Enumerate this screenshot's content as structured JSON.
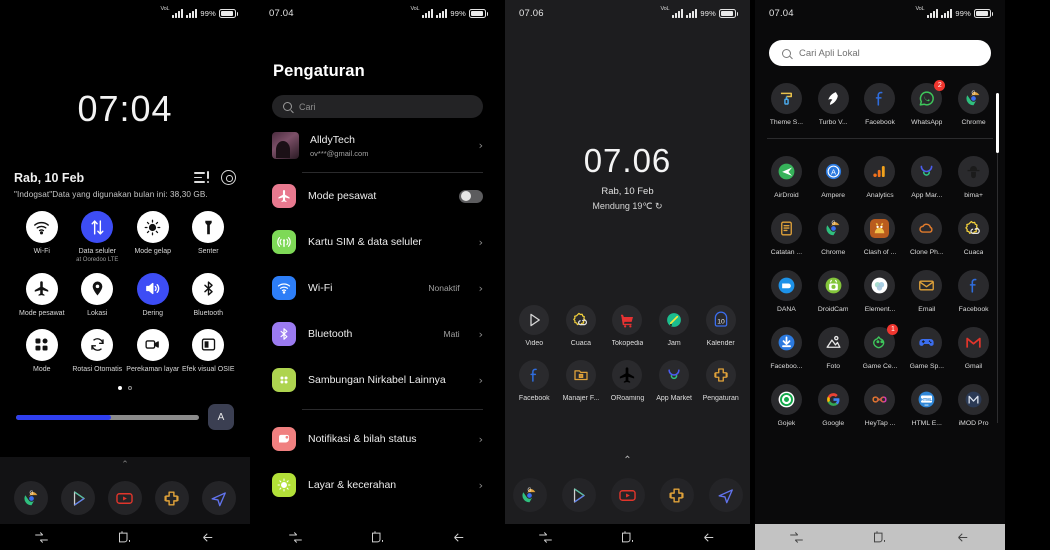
{
  "panel1": {
    "name": "notification-shade",
    "statusbar": {
      "time": "",
      "network": "VoLTE",
      "battery_pct": "99%"
    },
    "clock": "07:04",
    "date": "Rab, 10 Feb",
    "carrier_note": "\"Indogsat\"Data yang digunakan bulan ini: 38,30 GB.",
    "tiles": [
      {
        "label": "Wi-Fi",
        "sub": "",
        "icon": "wifi-icon",
        "active": false
      },
      {
        "label": "Data seluler",
        "sub": "at Ooredoo   LTE",
        "icon": "data-transfer-icon",
        "active": true
      },
      {
        "label": "Mode gelap",
        "sub": "",
        "icon": "brightness-icon",
        "active": false
      },
      {
        "label": "Senter",
        "sub": "",
        "icon": "flashlight-icon",
        "active": false
      },
      {
        "label": "Mode pesawat",
        "sub": "",
        "icon": "airplane-icon",
        "active": false
      },
      {
        "label": "Lokasi",
        "sub": "",
        "icon": "location-pin-icon",
        "active": false
      },
      {
        "label": "Dering",
        "sub": "",
        "icon": "volume-icon",
        "active": true
      },
      {
        "label": "Bluetooth",
        "sub": "",
        "icon": "bluetooth-icon",
        "active": false
      },
      {
        "label": "Mode",
        "sub": "",
        "icon": "grid-icon",
        "active": false
      },
      {
        "label": "Rotasi Otomatis",
        "sub": "",
        "icon": "rotate-icon",
        "active": false
      },
      {
        "label": "Perekaman layar",
        "sub": "",
        "icon": "screen-record-icon",
        "active": false
      },
      {
        "label": "Efek visual OSIE",
        "sub": "",
        "icon": "osie-icon",
        "active": false
      }
    ],
    "brightness_pct": 52,
    "auto_brightness_label": "A",
    "page_dots": 2,
    "active_dot": 0,
    "dock": [
      "chrome-icon",
      "play-store-icon",
      "youtube-icon",
      "oppo-market-icon",
      "navigation-icon"
    ]
  },
  "panel2": {
    "name": "settings-screen",
    "statusbar": {
      "time": "07.04",
      "battery_pct": "99%"
    },
    "title": "Pengaturan",
    "search_placeholder": "Cari",
    "account": {
      "name": "AlldyTech",
      "email": "ov***@gmail.com"
    },
    "rows": [
      {
        "label": "Mode pesawat",
        "value": "",
        "control": "toggle",
        "toggle_on": false,
        "icon": "airplane-icon",
        "color": "#e8798f"
      },
      {
        "label": "Kartu SIM & data seluler",
        "value": "",
        "control": "chevron",
        "icon": "signal-tower-icon",
        "color": "#7ed957"
      },
      {
        "label": "Wi-Fi",
        "value": "Nonaktif",
        "control": "chevron",
        "icon": "wifi-icon",
        "color": "#2d7ef7"
      },
      {
        "label": "Bluetooth",
        "value": "Mati",
        "control": "chevron",
        "icon": "bluetooth-icon",
        "color": "#9b7bf0"
      },
      {
        "label": "Sambungan Nirkabel Lainnya",
        "value": "",
        "control": "chevron",
        "icon": "dots-grid-icon",
        "color": "#aed44f"
      },
      {
        "label": "Notifikasi & bilah status",
        "value": "",
        "control": "chevron",
        "icon": "notification-icon",
        "color": "#f08080"
      },
      {
        "label": "Layar & kecerahan",
        "value": "",
        "control": "chevron",
        "icon": "brightness-icon",
        "color": "#b2e038"
      }
    ]
  },
  "panel3": {
    "name": "home-screen",
    "statusbar": {
      "time": "07.06",
      "battery_pct": "99%"
    },
    "clock": "07.06",
    "date": "Rab, 10 Feb",
    "weather": "Mendung 19℃  ↻",
    "apps": [
      {
        "label": "Video",
        "icon": "video-player-icon"
      },
      {
        "label": "Cuaca",
        "icon": "weather-icon"
      },
      {
        "label": "Tokopedia",
        "icon": "tokopedia-icon"
      },
      {
        "label": "Jam",
        "icon": "clock-icon"
      },
      {
        "label": "Kalender",
        "icon": "calendar-icon"
      },
      {
        "label": "Facebook",
        "icon": "facebook-icon"
      },
      {
        "label": "Manajer F...",
        "icon": "file-manager-icon"
      },
      {
        "label": "ORoaming",
        "icon": "airplane-icon"
      },
      {
        "label": "App Market",
        "icon": "app-market-icon"
      },
      {
        "label": "Pengaturan",
        "icon": "settings-icon"
      }
    ],
    "dock": [
      "chrome-icon",
      "play-store-icon",
      "youtube-icon",
      "oppo-market-icon",
      "navigation-icon"
    ]
  },
  "panel4": {
    "name": "app-drawer",
    "statusbar": {
      "time": "07.04",
      "battery_pct": "99%"
    },
    "search_placeholder": "Cari Apli Lokal",
    "apps": [
      {
        "label": "Theme S...",
        "icon": "theme-store-icon",
        "badge": ""
      },
      {
        "label": "Turbo V...",
        "icon": "turbo-vpn-icon",
        "badge": ""
      },
      {
        "label": "Facebook",
        "icon": "facebook-icon",
        "badge": ""
      },
      {
        "label": "WhatsApp",
        "icon": "whatsapp-icon",
        "badge": "2"
      },
      {
        "label": "Chrome",
        "icon": "chrome-icon",
        "badge": ""
      },
      {
        "label": "AirDroid",
        "icon": "airdroid-icon",
        "badge": ""
      },
      {
        "label": "Ampere",
        "icon": "ampere-icon",
        "badge": ""
      },
      {
        "label": "Analytics",
        "icon": "analytics-icon",
        "badge": ""
      },
      {
        "label": "App Mar...",
        "icon": "app-market-icon",
        "badge": ""
      },
      {
        "label": "bima+",
        "icon": "bima-icon",
        "badge": ""
      },
      {
        "label": "Catatan ...",
        "icon": "notes-icon",
        "badge": ""
      },
      {
        "label": "Chrome",
        "icon": "chrome-icon",
        "badge": ""
      },
      {
        "label": "Clash of ...",
        "icon": "clash-of-clans-icon",
        "badge": ""
      },
      {
        "label": "Clone Ph...",
        "icon": "clone-phone-icon",
        "badge": ""
      },
      {
        "label": "Cuaca",
        "icon": "weather-icon",
        "badge": ""
      },
      {
        "label": "DANA",
        "icon": "dana-icon",
        "badge": ""
      },
      {
        "label": "DroidCam",
        "icon": "droidcam-icon",
        "badge": ""
      },
      {
        "label": "Element...",
        "icon": "element-icon",
        "badge": ""
      },
      {
        "label": "Email",
        "icon": "email-icon",
        "badge": ""
      },
      {
        "label": "Facebook",
        "icon": "facebook-icon",
        "badge": ""
      },
      {
        "label": "Faceboo...",
        "icon": "download-icon",
        "badge": ""
      },
      {
        "label": "Foto",
        "icon": "photos-icon",
        "badge": ""
      },
      {
        "label": "Game Ce...",
        "icon": "game-center-icon",
        "badge": "1"
      },
      {
        "label": "Game Sp...",
        "icon": "gamepad-icon",
        "badge": ""
      },
      {
        "label": "Gmail",
        "icon": "gmail-icon",
        "badge": ""
      },
      {
        "label": "Gojek",
        "icon": "gojek-icon",
        "badge": ""
      },
      {
        "label": "Google",
        "icon": "google-icon",
        "badge": ""
      },
      {
        "label": "HeyTap ...",
        "icon": "heytap-icon",
        "badge": ""
      },
      {
        "label": "HTML E...",
        "icon": "html-editor-icon",
        "badge": ""
      },
      {
        "label": "iMOD Pro",
        "icon": "imod-icon",
        "badge": ""
      }
    ]
  },
  "navbar": {
    "recents": "recents-icon",
    "home": "home-icon",
    "back": "back-icon"
  },
  "colors": {
    "accent_blue": "#3d4df5",
    "badge_red": "#f0362f",
    "shade_bg": "#000000",
    "home_bg": "#1d1d1f"
  }
}
